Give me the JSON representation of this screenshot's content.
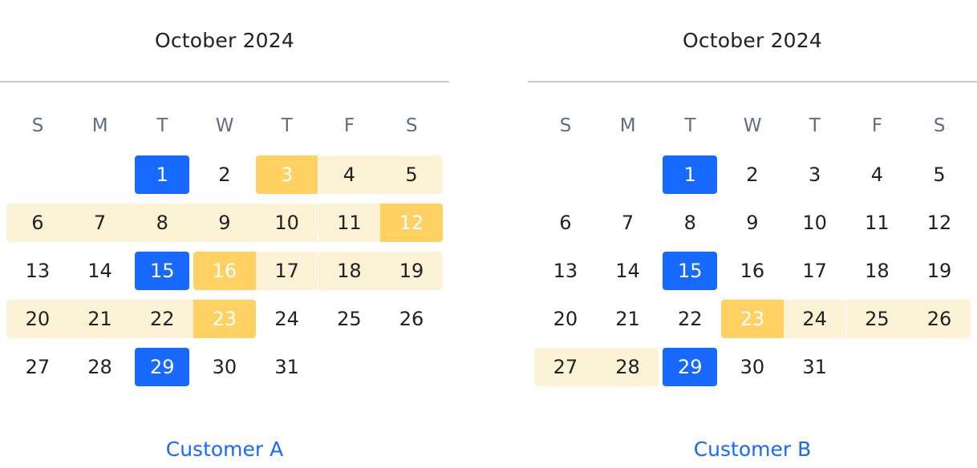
{
  "calendars": [
    {
      "month": "October 2024",
      "weekdays": [
        "S",
        "M",
        "T",
        "W",
        "T",
        "F",
        "S"
      ],
      "first_weekday_index": 2,
      "days_in_month": 31,
      "blue_days": [
        1,
        15,
        29
      ],
      "peak_days": [
        3,
        12,
        16,
        23
      ],
      "range_days": [
        3,
        4,
        5,
        6,
        7,
        8,
        9,
        10,
        11,
        12,
        16,
        17,
        18,
        19,
        20,
        21,
        22,
        23
      ],
      "range_segments": [
        [
          3,
          12
        ],
        [
          16,
          23
        ]
      ],
      "customer_label": "Customer A"
    },
    {
      "month": "October 2024",
      "weekdays": [
        "S",
        "M",
        "T",
        "W",
        "T",
        "F",
        "S"
      ],
      "first_weekday_index": 2,
      "days_in_month": 31,
      "blue_days": [
        1,
        15,
        29
      ],
      "peak_days": [
        23
      ],
      "range_days": [
        23,
        24,
        25,
        26,
        27,
        28,
        29
      ],
      "range_segments": [
        [
          23,
          29
        ]
      ],
      "customer_label": "Customer B"
    }
  ],
  "colors": {
    "blue": "#1769ff",
    "peak": "#ffd163",
    "range": "#fcf3d6",
    "weekday_text": "#5e6e88",
    "divider": "#c8cad6"
  }
}
